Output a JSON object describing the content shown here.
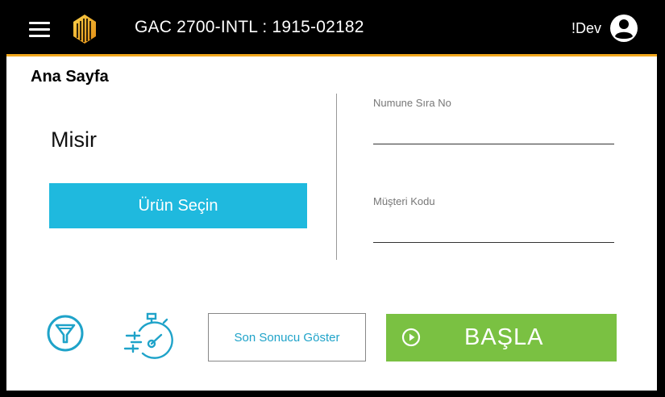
{
  "header": {
    "title": "GAC 2700-INTL : 1915-02182",
    "user_label": "!Dev",
    "menu_icon": "hamburger-menu-icon",
    "logo_icon": "brand-logo-icon",
    "user_icon": "user-account-icon"
  },
  "page": {
    "title": "Ana Sayfa"
  },
  "product": {
    "name": "Misir",
    "select_label": "Ürün Seçin"
  },
  "fields": {
    "sample_no": {
      "label": "Numune Sıra No",
      "value": ""
    },
    "customer_code": {
      "label": "Müşteri Kodu",
      "value": ""
    }
  },
  "actions": {
    "funnel_icon": "funnel-icon",
    "timer_icon": "stopwatch-icon",
    "show_last_label": "Son Sonucu Göster",
    "start_label": "BAŞLA",
    "play_icon": "play-circle-icon"
  },
  "colors": {
    "accent_bar": "#f2a81d",
    "select_button": "#1fb9de",
    "start_button": "#7ac142",
    "icon_blue": "#1fa3c9"
  }
}
